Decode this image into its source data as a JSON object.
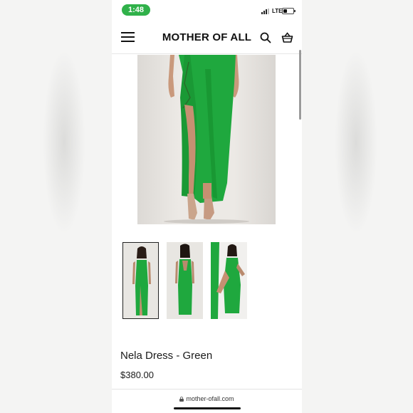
{
  "status_bar": {
    "time": "1:48",
    "network": "LTE",
    "battery_level": 0.3
  },
  "header": {
    "brand": "MOTHER OF ALL",
    "icons": [
      "menu-icon",
      "search-icon",
      "cart-icon"
    ]
  },
  "gallery": {
    "main_image": "green-dress-main-photo",
    "thumbnails": [
      "dress-front-thumbnail",
      "dress-back-thumbnail",
      "dress-side-thumbnail"
    ],
    "selected_index": 0
  },
  "product": {
    "name": "Nela Dress - Green",
    "price": "$380.00"
  },
  "browser": {
    "url": "mother-ofall.com"
  },
  "colors": {
    "accent": "#30b14a",
    "dress": "#1fa83e",
    "background": "#ffffff"
  }
}
